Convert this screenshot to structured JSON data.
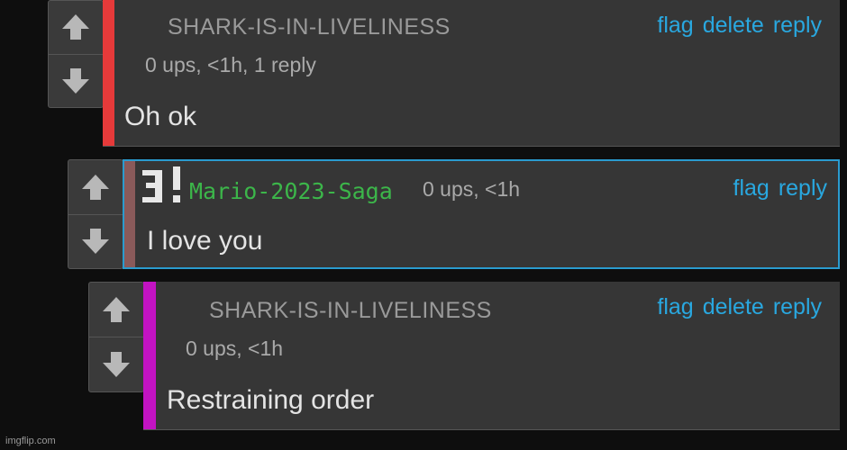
{
  "comments": [
    {
      "username": "SHARK-IS-IN-LIVELINESS",
      "meta": "0 ups, <1h, 1 reply",
      "body": "Oh ok",
      "stripe_color": "#e63a3a",
      "actions": {
        "flag": "flag",
        "delete": "delete",
        "reply": "reply"
      }
    },
    {
      "username": "Mario-2023-Saga",
      "username_color": "#3cb64a",
      "meta": "0 ups, <1h",
      "body": "I love you",
      "stripe_color": "#8a5a5a",
      "badge_icon": "pixel-3-exclamation-icon",
      "actions": {
        "flag": "flag",
        "reply": "reply"
      }
    },
    {
      "username": "SHARK-IS-IN-LIVELINESS",
      "meta": "0 ups, <1h",
      "body": "Restraining order",
      "stripe_color": "#c213c2",
      "actions": {
        "flag": "flag",
        "delete": "delete",
        "reply": "reply"
      }
    }
  ],
  "icons": {
    "upvote": "up-arrow-icon",
    "downvote": "down-arrow-icon"
  },
  "accent_color": "#29a8e0",
  "footer": "imgflip.com"
}
